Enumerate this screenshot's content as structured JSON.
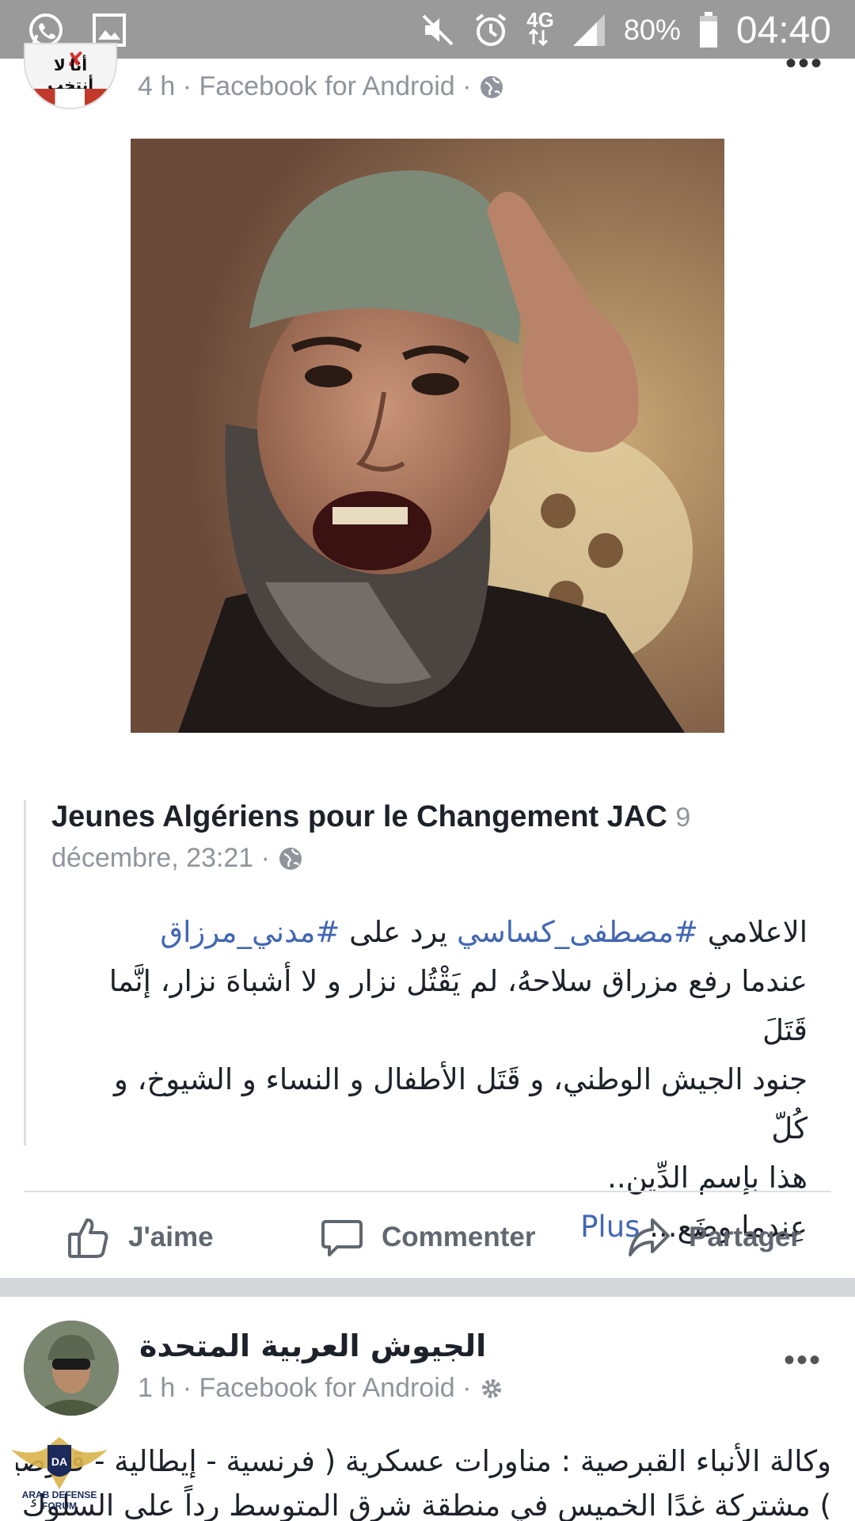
{
  "status_bar": {
    "network": "4G",
    "battery": "80%",
    "time": "04:40",
    "icons": [
      "whatsapp-icon",
      "image-icon",
      "mute-icon",
      "alarm-icon",
      "network-arrows-icon",
      "signal-icon",
      "battery-icon"
    ]
  },
  "post1": {
    "meta": "4 h · Facebook for Android ·",
    "avatar_text": "أنا لا أنتخب",
    "photo_alt": "portrait photo"
  },
  "shared": {
    "title": "Jeunes Algériens pour le Changement JAC",
    "day": "9",
    "date": "décembre, 23:21 ·",
    "line1_a": "الاعلامي ",
    "line1_tag1": "#مصطفى_كساسي",
    "line1_b": " يرد على ",
    "line1_tag2": "#مدني_مرزاق",
    "line2": "عندما رفع مزراق سلاحهُ، لم يَقْتُل نزار و لا أشباهَ نزار، إنَّما قَتَلَ",
    "line3": "جنود الجيش الوطني، و قَتَل الأطفال و النساء و الشيوخ، و كُلّ",
    "line4": "هذا بإسم الدِّين..",
    "line5": "عِندما وضَع... ",
    "more": "Plus"
  },
  "actions": {
    "like": "J'aime",
    "comment": "Commenter",
    "share": "Partager"
  },
  "post2": {
    "author": "الجيوش العربية المتحدة",
    "meta": "1 h · Facebook for Android ·",
    "body_line1": "وكالة الأنباء القبرصية : مناورات عسكرية ( فرنسية - إيطالية - قبرصية",
    "body_line2": ") مشتركة غدًا الخميس في منطقة شرق المتوسط رداً على السلوك"
  },
  "watermark": {
    "text": "ARAB DEFENSE FORUM"
  }
}
